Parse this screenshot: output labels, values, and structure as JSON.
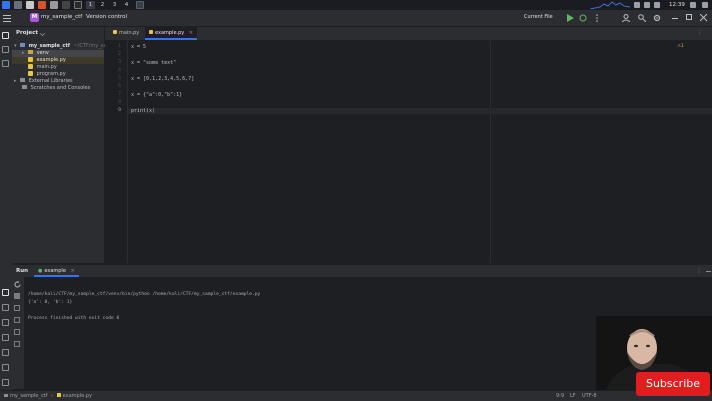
{
  "taskbar": {
    "workspaces": [
      "1",
      "2",
      "3",
      "4"
    ],
    "clock": "12:39"
  },
  "toolbar": {
    "project_label": "my_sample_ctf",
    "project_badge": "M",
    "vcs_label": "Version control",
    "run_config": "Current File"
  },
  "project_panel": {
    "title": "Project",
    "tree": [
      {
        "label": "my_sample_ctf",
        "suffix": "~/CTF/my_sam",
        "level": 0,
        "kind": "folder",
        "bold": true
      },
      {
        "label": "venv",
        "level": 1,
        "kind": "folder",
        "selected": true
      },
      {
        "label": "example.py",
        "level": 2,
        "kind": "file",
        "highlight": true
      },
      {
        "label": "main.py",
        "level": 2,
        "kind": "file"
      },
      {
        "label": "program.py",
        "level": 2,
        "kind": "file"
      },
      {
        "label": "External Libraries",
        "level": 0,
        "kind": "lib"
      },
      {
        "label": "Scratches and Consoles",
        "level": 0,
        "kind": "scratch"
      }
    ]
  },
  "editor": {
    "tabs": [
      {
        "label": "main.py",
        "active": false
      },
      {
        "label": "example.py",
        "active": true
      }
    ],
    "inspection": "1",
    "lines": [
      {
        "num": "1",
        "text": "x = 5"
      },
      {
        "num": "2",
        "text": ""
      },
      {
        "num": "3",
        "text": "x = \"some text\""
      },
      {
        "num": "4",
        "text": ""
      },
      {
        "num": "5",
        "text": "x = [0,1,2,3,4,5,6,7]"
      },
      {
        "num": "6",
        "text": ""
      },
      {
        "num": "7",
        "text": "x = {\"a\":0,\"b\":1}"
      },
      {
        "num": "8",
        "text": ""
      },
      {
        "num": "9",
        "text": "print(x)"
      }
    ]
  },
  "run_panel": {
    "title": "Run",
    "tab_label": "example",
    "output": [
      "/home/kali/CTF/my_sample_ctf/venv/bin/python /home/kali/CTF/my_sample_ctf/example.py",
      "{'a': 0, 'b': 1}",
      "",
      "Process finished with exit code 0"
    ]
  },
  "status_bar": {
    "breadcrumb": [
      "my_sample_ctf",
      "example.py"
    ],
    "position": "9:9",
    "line_sep": "LF",
    "encoding": "UTF-8"
  },
  "overlay": {
    "subscribe_label": "Subscribe"
  },
  "colors": {
    "accent": "#3574f0",
    "subscribe": "#e11d1d",
    "run_green": "#5fb865"
  }
}
